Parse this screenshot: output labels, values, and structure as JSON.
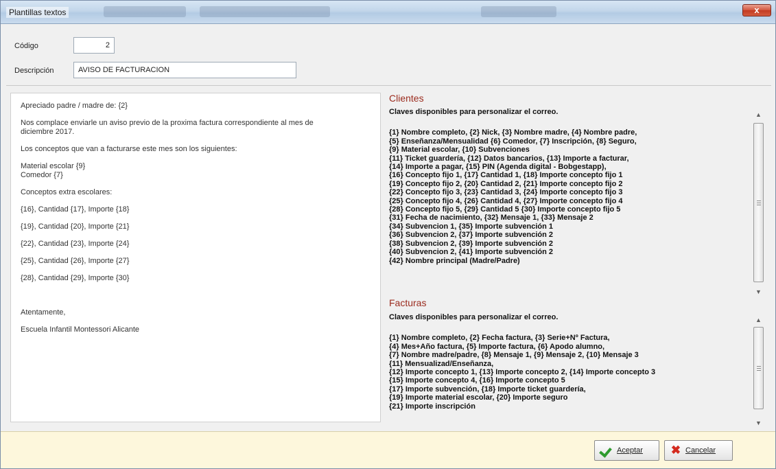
{
  "window": {
    "title": "Plantillas textos",
    "close_glyph": "x"
  },
  "header": {
    "codigo_label": "Código",
    "codigo_value": "2",
    "descripcion_label": "Descripción",
    "descripcion_value": "AVISO DE FACTURACION"
  },
  "editor": {
    "paragraphs": [
      [
        "Apreciado padre / madre de: {2}"
      ],
      [
        "Nos complace enviarle un aviso previo de la proxima factura correspondiente al mes de",
        "diciembre 2017."
      ],
      [
        "Los conceptos que van a facturarse este mes son los siguientes:"
      ],
      [
        "Material escolar {9}",
        "Comedor {7}"
      ],
      [
        "Conceptos extra escolares:"
      ],
      [
        "{16}, Cantidad {17}, Importe {18}"
      ],
      [
        "{19}, Cantidad {20}, Importe {21}"
      ],
      [
        "{22}, Cantidad {23}, Importe {24}"
      ],
      [
        "{25}, Cantidad {26}, Importe {27}"
      ],
      [
        "{28}, Cantidad {29}, Importe {30}"
      ],
      [
        ""
      ],
      [
        "Atentamente,"
      ],
      [
        "Escuela Infantil Montessori Alicante"
      ]
    ]
  },
  "clientes": {
    "title": "Clientes",
    "intro": "Claves disponibles para personalizar el correo.",
    "lines": [
      "{1} Nombre completo, {2} Nick, {3} Nombre madre, {4} Nombre padre,",
      "{5} Enseñanza/Mensualidad {6} Comedor, {7} Inscripción, {8} Seguro,",
      "{9} Material escolar, {10} Subvenciones",
      "{11} Ticket guardería, {12} Datos bancarios, {13} Importe a facturar,",
      "{14} Importe a pagar, {15} PIN (Agenda digital - Bobgestapp),",
      "{16} Concepto fijo 1, {17} Cantidad 1, {18} Importe concepto fijo 1",
      "{19} Concepto fijo 2, {20} Cantidad 2, {21} Importe concepto fijo 2",
      "{22} Concepto fijo 3, {23} Cantidad 3, {24} Importe concepto fijo 3",
      "{25} Concepto fijo 4, {26} Cantidad 4, {27} Importe concepto fijo 4",
      "{28} Concepto fijo 5, {29} Cantidad 5 {30} Importe concepto fijo 5",
      "{31} Fecha de nacimiento, {32} Mensaje 1, {33} Mensaje 2",
      "{34} Subvencion 1, {35} Importe subvención 1",
      "{36} Subvencion 2, {37} Importe subvención 2",
      "{38} Subvencion 2, {39} Importe subvención 2",
      "{40} Subvencion 2, {41} Importe subvención 2",
      "{42} Nombre principal (Madre/Padre)"
    ]
  },
  "facturas": {
    "title": "Facturas",
    "intro": "Claves disponibles para personalizar el correo.",
    "lines": [
      "{1} Nombre completo, {2} Fecha factura, {3} Serie+Nº Factura,",
      "{4} Mes+Año factura, {5} Importe factura, {6} Apodo alumno,",
      "{7} Nombre madre/padre, {8} Mensaje 1, {9} Mensaje 2, {10} Mensaje 3",
      "{11} Mensualizad/Enseñanza,",
      "{12} Importe concepto 1, {13} Importe concepto 2, {14} Importe concepto 3",
      "{15} Importe concepto 4, {16} Importe concepto 5",
      "{17} Importe subvención, {18} Importe ticket guardería,",
      "{19} Importe material escolar, {20} Importe seguro",
      "{21} Importe inscripción"
    ]
  },
  "buttons": {
    "accept_label": "Aceptar",
    "cancel_label": "Cancelar",
    "accept_icon": "check-icon",
    "cancel_icon": "x-icon"
  },
  "colors": {
    "section_title": "#9b2b1e",
    "bottom_bar": "#fdf7dc",
    "accept_check": "#2e9a2e",
    "cancel_x": "#d42b1e"
  }
}
